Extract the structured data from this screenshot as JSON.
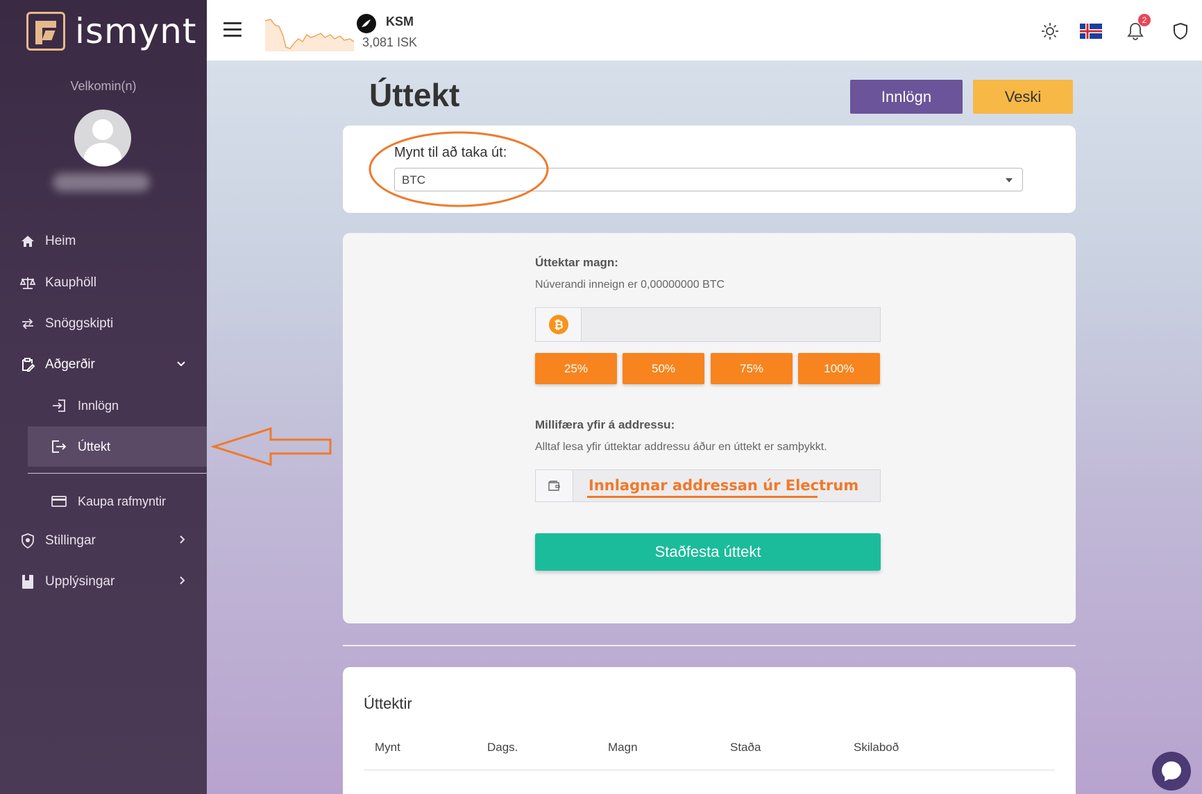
{
  "brand": {
    "name": "ismynt"
  },
  "sidebar": {
    "welcome": "Velkomin(n)",
    "items": [
      {
        "label": "Heim"
      },
      {
        "label": "Kauphöll"
      },
      {
        "label": "Snöggskipti"
      },
      {
        "label": "Aðgerðir"
      },
      {
        "label": "Innlögn"
      },
      {
        "label": "Úttekt"
      },
      {
        "label": "Kaupa rafmyntir"
      },
      {
        "label": "Stillingar"
      },
      {
        "label": "Upplýsingar"
      }
    ]
  },
  "topbar": {
    "coin_symbol": "KSM",
    "coin_price": "3,081 ISK",
    "notification_count": "2"
  },
  "page": {
    "title": "Úttekt",
    "deposit_button": "Innlögn",
    "wallet_button": "Veski"
  },
  "coin_select": {
    "label": "Mynt til að taka út:",
    "value": "BTC"
  },
  "amount": {
    "title": "Úttektar magn:",
    "subtitle": "Núverandi inneign er 0,00000000 BTC",
    "value": "",
    "percent_buttons": [
      "25%",
      "50%",
      "75%",
      "100%"
    ]
  },
  "address": {
    "title": "Millifæra yfir á addressu:",
    "subtitle": "Alltaf lesa yfir úttektar addressu áður en úttekt er samþykkt.",
    "annotation": "Innlagnar addressan úr Electrum"
  },
  "confirm_button": "Staðfesta úttekt",
  "history": {
    "title": "Úttektir",
    "columns": [
      "Mynt",
      "Dags.",
      "Magn",
      "Staða",
      "Skilaboð"
    ]
  },
  "colors": {
    "sidebar_bg": "#3b2a44",
    "deposit": "#6b5499",
    "wallet": "#f7b845",
    "percent": "#f7841e",
    "confirm": "#1bbc9b",
    "annotation": "#f0792a",
    "badge": "#e8455a"
  },
  "icons": {
    "home": "home-icon",
    "exchange": "scale-icon",
    "swap": "swap-arrows-icon",
    "actions": "clipboard-edit-icon",
    "deposit": "sign-in-icon",
    "withdraw": "sign-out-icon",
    "buy": "credit-card-icon",
    "settings": "shield-icon",
    "info": "book-icon",
    "theme": "sun-icon",
    "language": "iceland-flag-icon",
    "notifications": "bell-icon",
    "security": "shield-outline-icon",
    "chat": "chat-bubble-icon"
  }
}
